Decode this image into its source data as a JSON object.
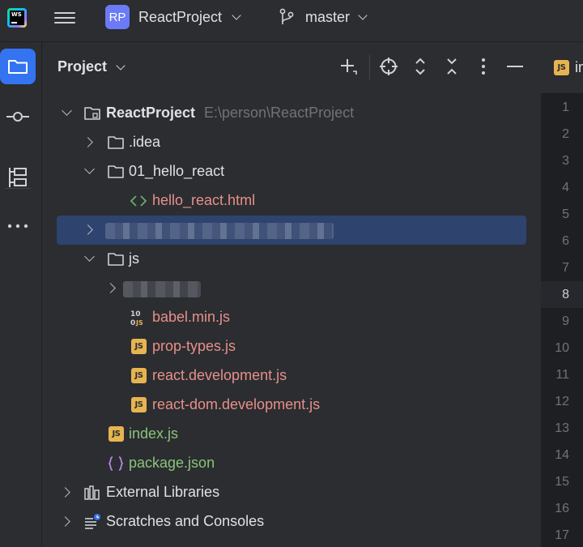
{
  "app": {
    "logo_text": "WS",
    "project_badge": "RP",
    "project_name": "ReactProject",
    "branch": "master"
  },
  "toolstrip": {
    "items": [
      "project-icon",
      "commit-icon",
      "structure-icon",
      "more-icon"
    ]
  },
  "panel": {
    "title": "Project",
    "actions": [
      "add-icon",
      "locate-icon",
      "expand-all-icon",
      "collapse-all-icon",
      "options-icon",
      "hide-icon"
    ]
  },
  "tree": {
    "root": {
      "label": "ReactProject",
      "path": "E:\\person\\ReactProject"
    },
    "idea": {
      "label": ".idea"
    },
    "hello_folder": {
      "label": "01_hello_react"
    },
    "hello_file": {
      "label": "hello_react.html"
    },
    "js_folder": {
      "label": "js"
    },
    "babel": {
      "label": "babel.min.js"
    },
    "prop_types": {
      "label": "prop-types.js"
    },
    "react_dev": {
      "label": "react.development.js"
    },
    "react_dom": {
      "label": "react-dom.development.js"
    },
    "index": {
      "label": "index.js"
    },
    "package": {
      "label": "package.json"
    },
    "external": {
      "label": "External Libraries"
    },
    "scratches": {
      "label": "Scratches and Consoles"
    }
  },
  "editor": {
    "tab_label": "in",
    "js_badge": "JS",
    "current_line": "8",
    "lines": [
      "1",
      "2",
      "3",
      "4",
      "5",
      "6",
      "7",
      "8",
      "9",
      "10",
      "11",
      "12",
      "13",
      "14",
      "15",
      "16",
      "17"
    ]
  },
  "colors": {
    "accent": "#3574f0",
    "selection": "#2e436e",
    "html_file": "#e88f8a",
    "new_file": "#89c47a",
    "js_badge": "#e6b450"
  }
}
